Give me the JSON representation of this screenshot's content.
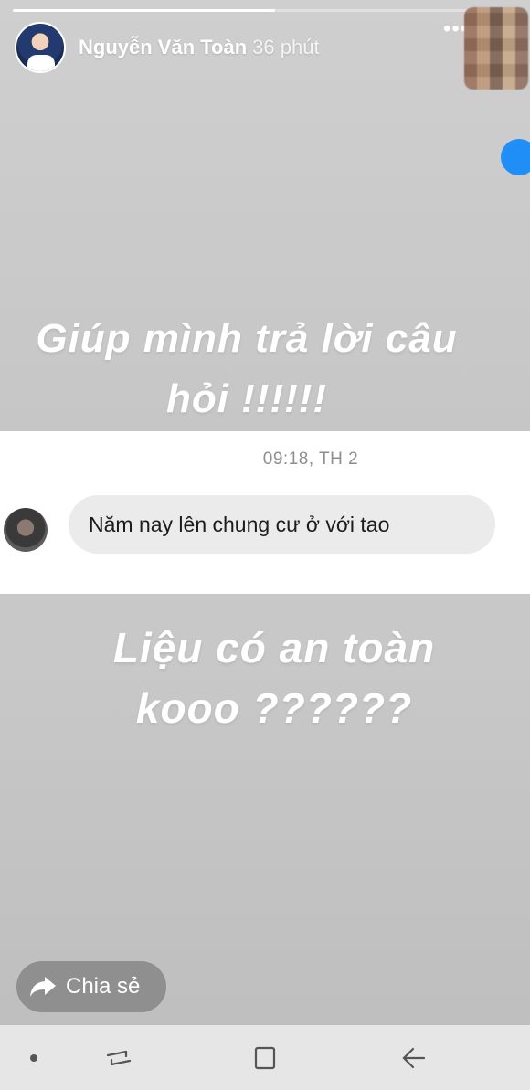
{
  "story": {
    "progress": 0.52,
    "username": "Nguyễn Văn Toàn",
    "time_ago": "36 phút",
    "more_icon": "more-horizontal-icon"
  },
  "captions": {
    "top_line1": "Giúp mình trả lời câu",
    "top_line2": "hỏi !!!!!!",
    "bottom_line1": "Liệu có an toàn",
    "bottom_line2": "kooo ??????"
  },
  "message": {
    "timestamp": "09:18, TH 2",
    "text": "Năm nay lên chung cư ở với tao"
  },
  "actions": {
    "share_label": "Chia sẻ",
    "share_icon": "share-arrow-icon"
  },
  "navbar": {
    "icons": [
      "dot-icon",
      "recent-apps-icon",
      "home-icon",
      "back-icon"
    ]
  },
  "colors": {
    "message_bubble": "#ebebeb",
    "seen_indicator": "#1f8ff7",
    "share_button": "#8f8f8f"
  }
}
